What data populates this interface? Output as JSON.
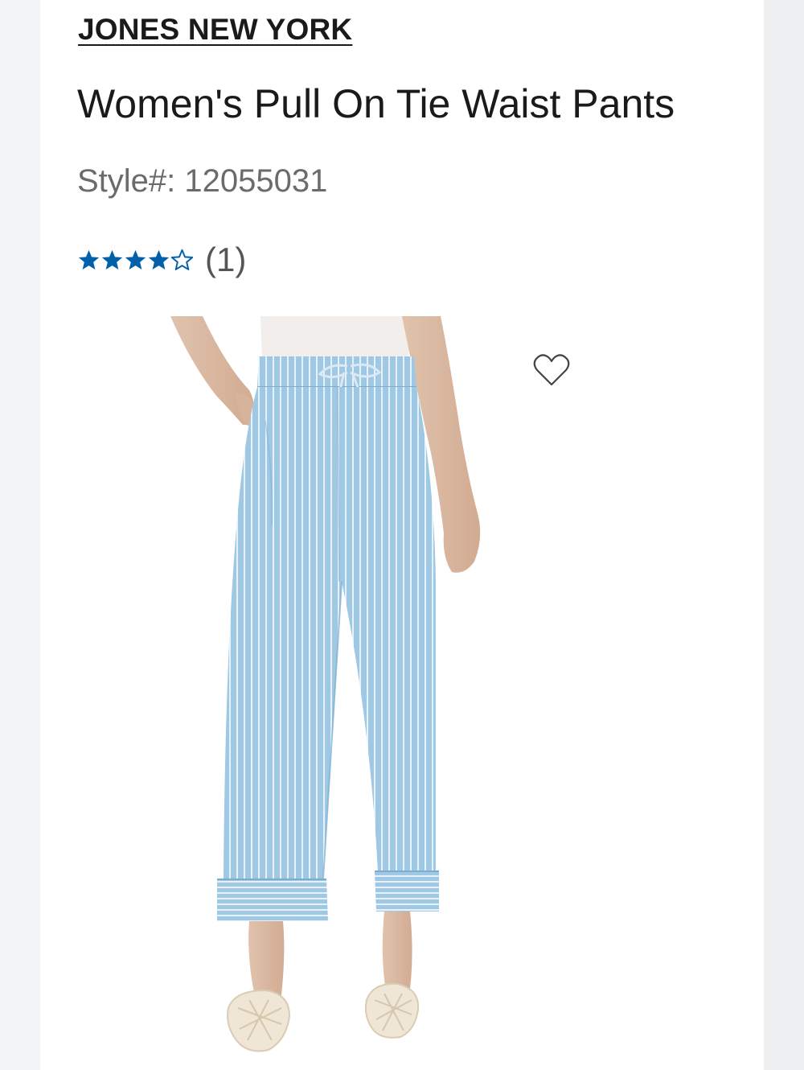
{
  "product": {
    "brand": "JONES NEW YORK",
    "title": "Women's Pull On Tie Waist Pants",
    "style_label": "Style#: 12055031",
    "rating": {
      "stars_filled": 4,
      "stars_total": 5,
      "count_label": "(1)"
    }
  },
  "icons": {
    "star": "star-icon",
    "favorite": "heart-outline-icon"
  },
  "colors": {
    "star_accent": "#0060a9",
    "text_primary": "#1a1a1a",
    "text_secondary": "#6b6b6b",
    "denim": "#9cc6e2"
  }
}
